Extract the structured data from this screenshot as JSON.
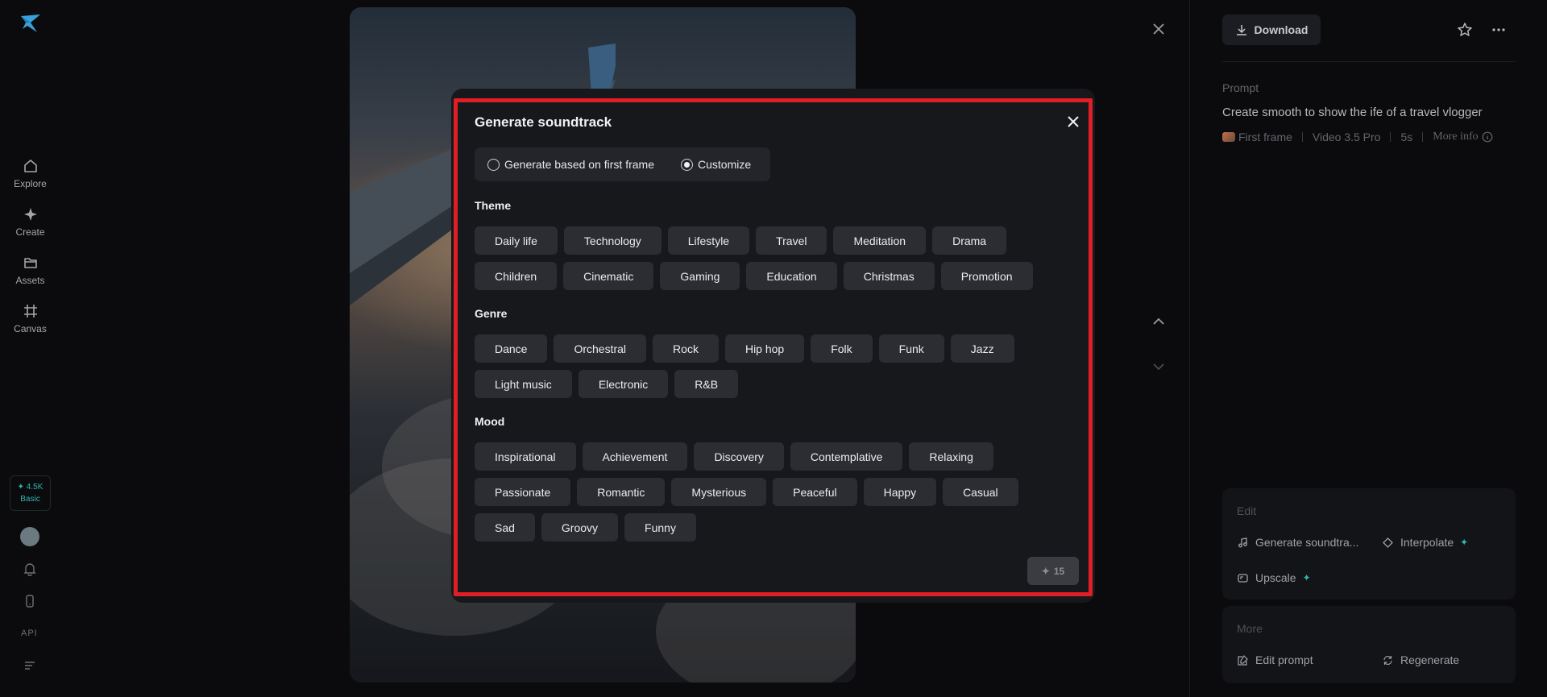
{
  "sidebar": {
    "nav": [
      {
        "label": "Explore",
        "icon": "home-icon"
      },
      {
        "label": "Create",
        "icon": "sparkle-icon"
      },
      {
        "label": "Assets",
        "icon": "folder-icon"
      },
      {
        "label": "Canvas",
        "icon": "canvas-icon"
      }
    ],
    "credits": {
      "amount": "✦ 4.5K",
      "plan": "Basic"
    },
    "api_label": "API"
  },
  "right_panel": {
    "download_label": "Download",
    "prompt_label": "Prompt",
    "prompt_text": "Create smooth to show the ife of a travel vlogger",
    "meta": {
      "first_frame": "First frame",
      "model": "Video 3.5 Pro",
      "duration": "5s",
      "more_info": "More info"
    },
    "edit_card": {
      "title": "Edit",
      "generate_soundtrack": "Generate soundtra...",
      "interpolate": "Interpolate",
      "upscale": "Upscale"
    },
    "more_card": {
      "title": "More",
      "edit_prompt": "Edit prompt",
      "regenerate": "Regenerate"
    }
  },
  "modal": {
    "title": "Generate soundtrack",
    "options": [
      {
        "label": "Generate based on first frame",
        "selected": false
      },
      {
        "label": "Customize",
        "selected": true
      }
    ],
    "theme_label": "Theme",
    "theme_row1": [
      "Daily life",
      "Technology",
      "Lifestyle",
      "Travel",
      "Meditation",
      "Drama"
    ],
    "theme_row2": [
      "Children",
      "Cinematic",
      "Gaming",
      "Education",
      "Christmas",
      "Promotion"
    ],
    "genre_label": "Genre",
    "genre_row1": [
      "Dance",
      "Orchestral",
      "Rock",
      "Hip hop",
      "Folk",
      "Funk",
      "Jazz"
    ],
    "genre_row2": [
      "Light music",
      "Electronic",
      "R&B"
    ],
    "mood_label": "Mood",
    "mood_row1": [
      "Inspirational",
      "Achievement",
      "Discovery",
      "Contemplative",
      "Relaxing"
    ],
    "mood_row2": [
      "Passionate",
      "Romantic",
      "Mysterious",
      "Peaceful",
      "Happy",
      "Casual"
    ],
    "mood_row3": [
      "Sad",
      "Groovy",
      "Funny"
    ],
    "generate_cost": "15"
  },
  "colors": {
    "accent": "#2fb7ad",
    "highlight_border": "#e01e26"
  }
}
